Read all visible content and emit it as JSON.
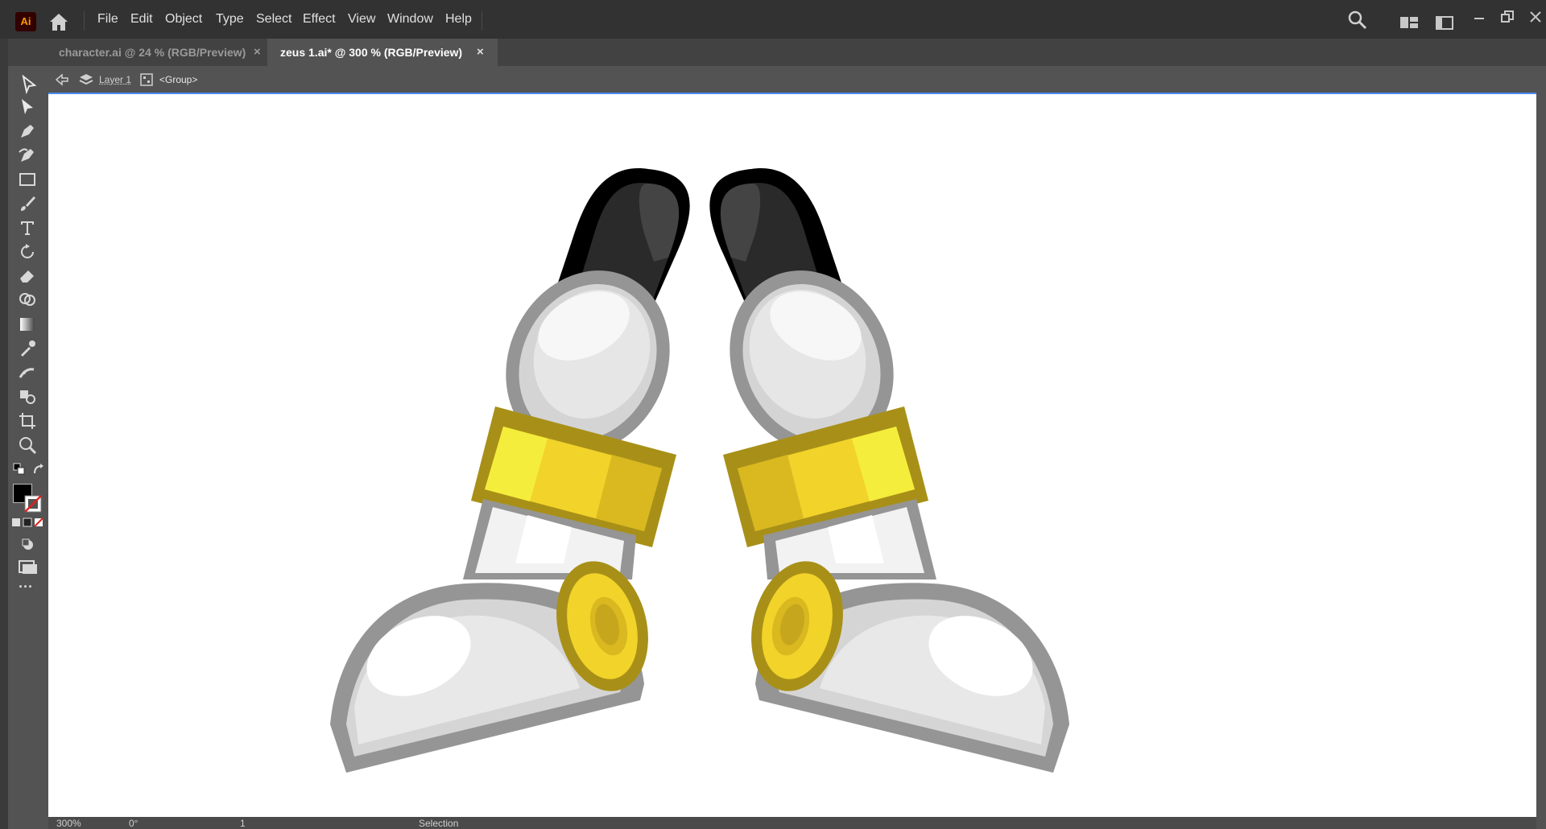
{
  "app": {
    "logo_text": "Ai"
  },
  "menu": [
    "File",
    "Edit",
    "Object",
    "Type",
    "Select",
    "Effect",
    "View",
    "Window",
    "Help"
  ],
  "tabs": [
    {
      "label": "character.ai @ 24 % (RGB/Preview)",
      "close": "×",
      "active": false
    },
    {
      "label": "zeus 1.ai* @ 300 % (RGB/Preview)",
      "close": "×",
      "active": true
    }
  ],
  "breadcrumb": {
    "layer": "Layer 1",
    "group": "<Group>"
  },
  "status": {
    "zoom": "300%",
    "rotation": "0°",
    "artboard": "1",
    "tool": "Selection"
  },
  "tools": [
    "selection-tool-icon",
    "direct-selection-tool-icon",
    "pen-tool-icon",
    "curvature-tool-icon",
    "rectangle-tool-icon",
    "paintbrush-tool-icon",
    "type-tool-icon",
    "rotate-tool-icon",
    "eraser-tool-icon",
    "shape-builder-tool-icon",
    "gradient-tool-icon",
    "eyedropper-tool-icon",
    "puppet-warp-tool-icon",
    "blend-tool-icon",
    "artboard-tool-icon",
    "zoom-tool-icon"
  ],
  "colors": {
    "fill": "#000000",
    "stroke": "none",
    "boot_gold": "#f2d32a",
    "boot_gold_dark": "#a89018",
    "boot_grey": "#959595"
  }
}
